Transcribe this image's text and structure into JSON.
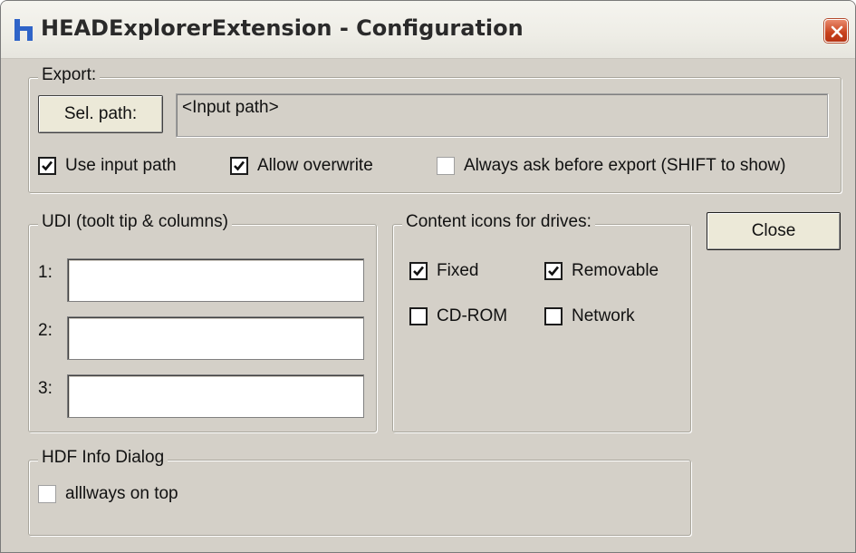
{
  "window": {
    "title": "HEADExplorerExtension - Configuration"
  },
  "export": {
    "legend": "Export:",
    "select_path_label": "Sel. path:",
    "path_value": "<Input path>",
    "use_input_path": {
      "label": "Use input path",
      "checked": true
    },
    "allow_overwrite": {
      "label": "Allow overwrite",
      "checked": true
    },
    "always_ask": {
      "label": "Always ask before export (SHIFT to show)",
      "checked": false
    }
  },
  "udi": {
    "legend": "UDI (toolt tip & columns)",
    "fields": [
      {
        "label": "1:",
        "value": ""
      },
      {
        "label": "2:",
        "value": ""
      },
      {
        "label": "3:",
        "value": ""
      }
    ]
  },
  "content_icons": {
    "legend": "Content icons for drives:",
    "fixed": {
      "label": "Fixed",
      "checked": true
    },
    "removable": {
      "label": "Removable",
      "checked": true
    },
    "cdrom": {
      "label": "CD-ROM",
      "checked": false
    },
    "network": {
      "label": "Network",
      "checked": false
    }
  },
  "close_label": "Close",
  "hdf_info": {
    "legend": "HDF Info Dialog",
    "always_on_top": {
      "label": "alllways on top",
      "checked": false
    }
  }
}
